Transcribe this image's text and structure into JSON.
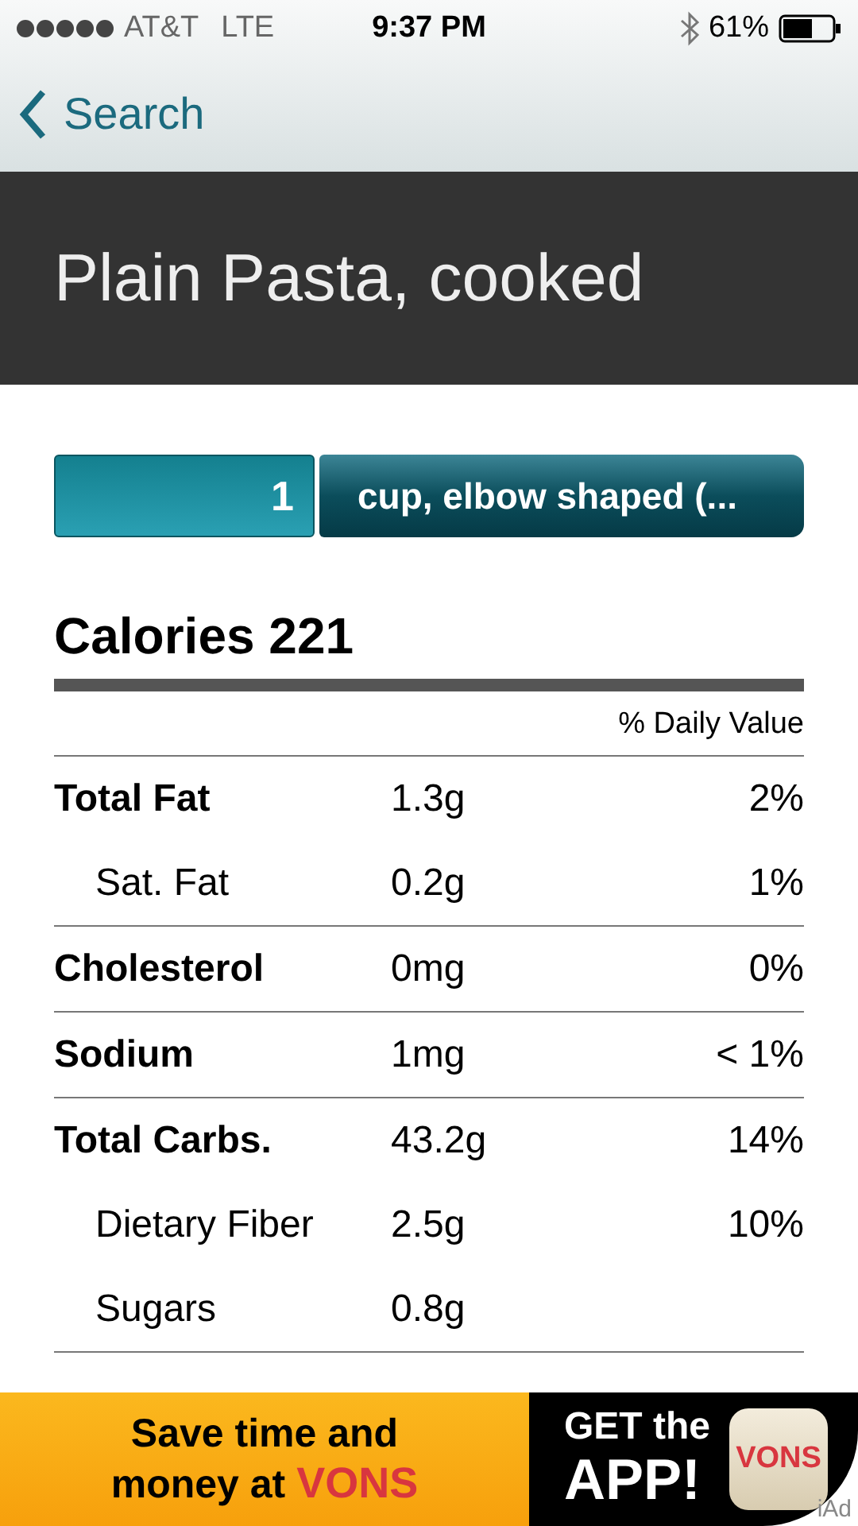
{
  "status_bar": {
    "carrier": "AT&T",
    "network": "LTE",
    "time": "9:37 PM",
    "battery": "61%"
  },
  "nav": {
    "back": "Search"
  },
  "title": "Plain Pasta, cooked",
  "serving": {
    "amount": "1",
    "unit": "cup, elbow shaped (..."
  },
  "calories": "Calories 221",
  "daily_value_header": "% Daily Value",
  "nutrients": [
    {
      "name": "Total Fat",
      "amount": "1.3g",
      "percent": "2%",
      "kind": "main"
    },
    {
      "name": "Sat. Fat",
      "amount": "0.2g",
      "percent": "1%",
      "kind": "sub"
    },
    {
      "name": "Cholesterol",
      "amount": "0mg",
      "percent": "0%",
      "kind": "main"
    },
    {
      "name": "Sodium",
      "amount": "1mg",
      "percent": "< 1%",
      "kind": "main"
    },
    {
      "name": "Total Carbs.",
      "amount": "43.2g",
      "percent": "14%",
      "kind": "main"
    },
    {
      "name": "Dietary Fiber",
      "amount": "2.5g",
      "percent": "10%",
      "kind": "sub"
    },
    {
      "name": "Sugars",
      "amount": "0.8g",
      "kind": "sub"
    }
  ],
  "ad": {
    "line_1": "Save time and",
    "line_2": "money at",
    "brand": "VONS",
    "cta_1": "GET the",
    "cta_2": "APP!",
    "app_icon_text": "VONS",
    "label": "iAd"
  }
}
